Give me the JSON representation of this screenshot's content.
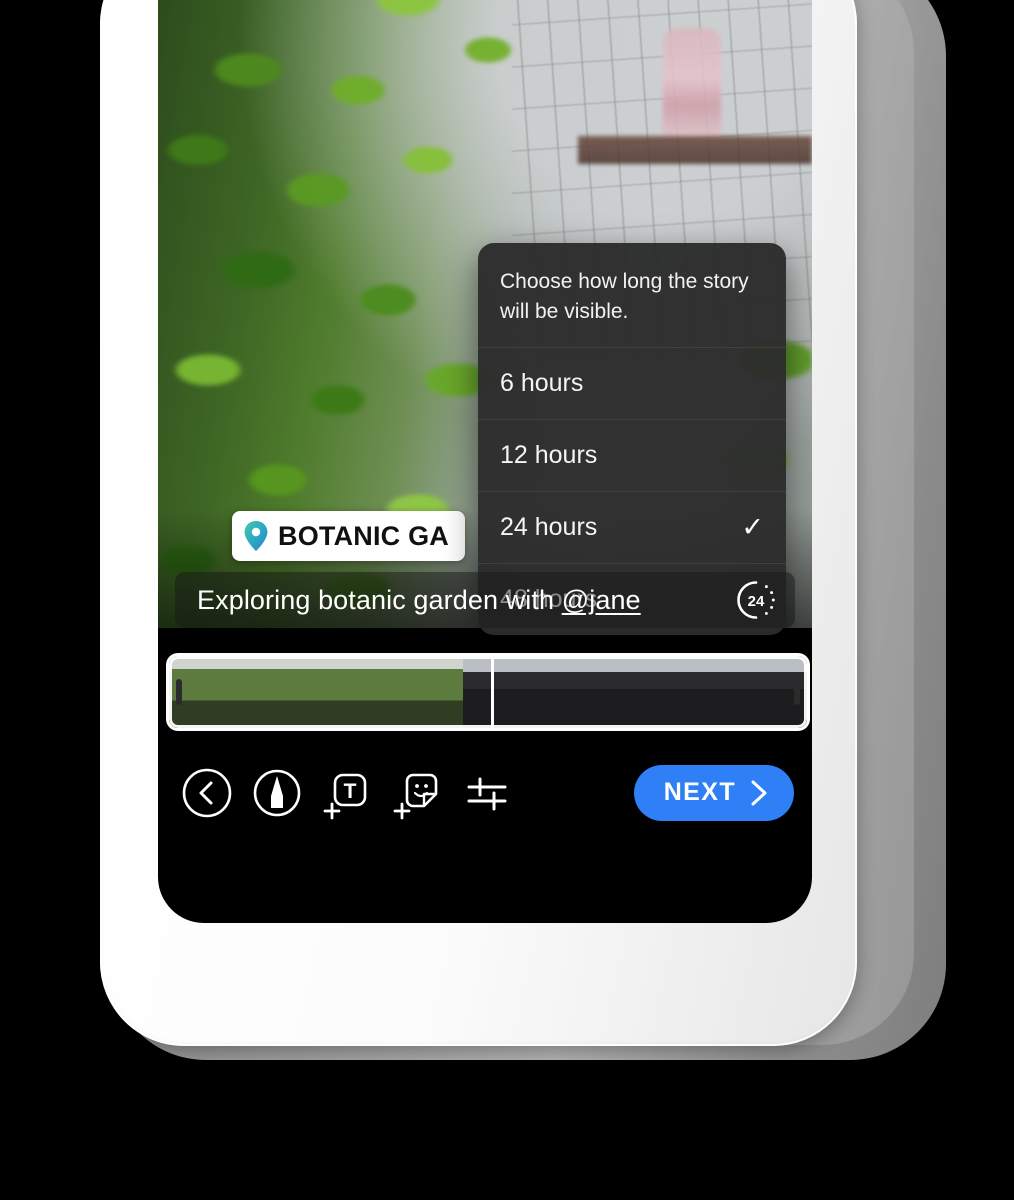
{
  "screen": {
    "app": "story-editor",
    "background_description": "Botanic garden video: green foliage on the left, misty glass wall and a person in a pink dress walking on the right"
  },
  "location_sticker": {
    "icon": "location-pin-icon",
    "label": "BOTANIC GA",
    "full_label_truncated": true,
    "pin_color": "#2aa8c4",
    "background": "#ffffff",
    "text_color": "#111111"
  },
  "duration_menu": {
    "prompt": "Choose how long the story will be visible.",
    "options": [
      {
        "label": "6 hours",
        "selected": false,
        "check": ""
      },
      {
        "label": "12 hours",
        "selected": false,
        "check": ""
      },
      {
        "label": "24 hours",
        "selected": true,
        "check": "✓"
      },
      {
        "label": "48 hours",
        "selected": false,
        "check": ""
      }
    ],
    "selected_value": "24 hours",
    "background": "#2c2c2c",
    "text_color": "#f5f5f5"
  },
  "caption": {
    "text_before": "Exploring botanic garden with ",
    "mention": "@jane",
    "full_text": "Exploring botanic garden with @jane",
    "duration_badge": {
      "icon": "duration-24-icon",
      "value": "24"
    }
  },
  "timeline": {
    "name": "video-trim-timeline",
    "left_handle": "trim-handle-left",
    "right_handle": "trim-handle-right",
    "playhead": "playhead"
  },
  "toolbar": {
    "items": [
      {
        "name": "back-button",
        "icon": "chevron-left-circle-icon",
        "label": "Back"
      },
      {
        "name": "draw-button",
        "icon": "pen-circle-icon",
        "label": "Draw"
      },
      {
        "name": "add-text-button",
        "icon": "add-text-icon",
        "label": "Add text"
      },
      {
        "name": "add-sticker-button",
        "icon": "add-sticker-icon",
        "label": "Add sticker"
      },
      {
        "name": "adjust-button",
        "icon": "sliders-icon",
        "label": "Adjust"
      }
    ],
    "next_button": {
      "label": "NEXT",
      "icon": "chevron-right-icon",
      "color": "#2f7ff7",
      "text_color": "#ffffff"
    }
  }
}
